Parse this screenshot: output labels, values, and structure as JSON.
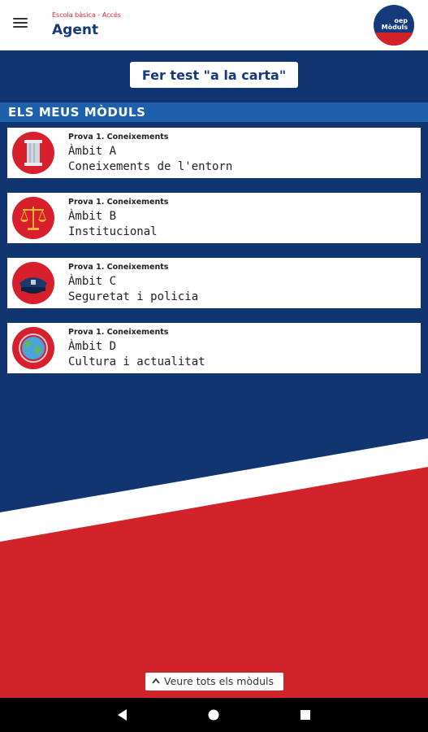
{
  "header": {
    "subtitle": "Escola bàsica - Accés",
    "title": "Agent",
    "menu_icon": "hamburger-menu-icon",
    "logo_icon": "app-logo-icon",
    "logo_text": "oep\nMòduls"
  },
  "actions": {
    "test_button": "Fer test \"a la carta\""
  },
  "section": {
    "title": "ELS MEUS MÒDULS"
  },
  "modules": [
    {
      "kicker": "Prova 1. Coneixements",
      "line1": "Àmbit A",
      "line2": "Coneixements de l'entorn",
      "icon": "column-pillar-icon"
    },
    {
      "kicker": "Prova 1. Coneixements",
      "line1": "Àmbit B",
      "line2": "Institucional",
      "icon": "scales-of-justice-icon"
    },
    {
      "kicker": "Prova 1. Coneixements",
      "line1": "Àmbit C",
      "line2": "Seguretat i policia",
      "icon": "police-cap-icon"
    },
    {
      "kicker": "Prova 1. Coneixements",
      "line1": "Àmbit D",
      "line2": "Cultura i actualitat",
      "icon": "globe-icon"
    }
  ],
  "footer": {
    "see_all": "Veure tots els mòduls",
    "see_all_icon": "chevron-up-icon"
  },
  "colors": {
    "navy": "#103570",
    "section_blue": "#1d61ad",
    "red": "#d2232a",
    "title_blue": "#143a7b"
  }
}
